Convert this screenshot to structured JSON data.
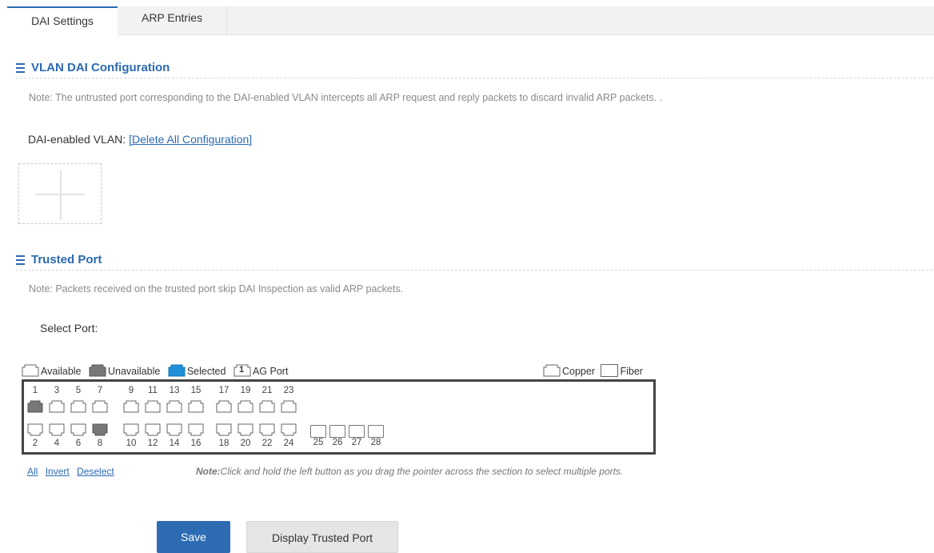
{
  "tabs": [
    {
      "label": "DAI Settings",
      "active": true
    },
    {
      "label": "ARP Entries",
      "active": false
    }
  ],
  "vlan_section": {
    "title": "VLAN DAI Configuration",
    "note": "Note: The untrusted port corresponding to the DAI-enabled VLAN intercepts all ARP request and reply packets to discard invalid ARP packets. .",
    "vlan_label": "DAI-enabled VLAN:",
    "delete_link": "[Delete All Configuration]"
  },
  "trusted_section": {
    "title": "Trusted Port",
    "note": "Note: Packets received on the trusted port skip DAI Inspection as valid ARP packets.",
    "select_label": "Select Port:"
  },
  "legend": {
    "available": "Available",
    "unavailable": "Unavailable",
    "selected": "Selected",
    "ag_port": "AG Port",
    "ag_number": "1",
    "copper": "Copper",
    "fiber": "Fiber"
  },
  "colors": {
    "accent": "#2b6ab3",
    "unavailable": "#777777",
    "selected": "#1f8fd8",
    "available": "#ffffff"
  },
  "ports": {
    "top_numbers": [
      "1",
      "3",
      "5",
      "7",
      "9",
      "11",
      "13",
      "15",
      "17",
      "19",
      "21",
      "23"
    ],
    "bottom_numbers": [
      "2",
      "4",
      "6",
      "8",
      "10",
      "12",
      "14",
      "16",
      "18",
      "20",
      "22",
      "24"
    ],
    "fiber_numbers": [
      "25",
      "26",
      "27",
      "28"
    ],
    "unavailable": [
      "1",
      "8"
    ]
  },
  "selection": {
    "all": "All",
    "invert": "Invert",
    "deselect": "Deselect",
    "note_bold": "Note:",
    "note_text": "Click and hold the left button as you drag the pointer across the section to select multiple ports."
  },
  "buttons": {
    "save": "Save",
    "display": "Display Trusted Port"
  }
}
